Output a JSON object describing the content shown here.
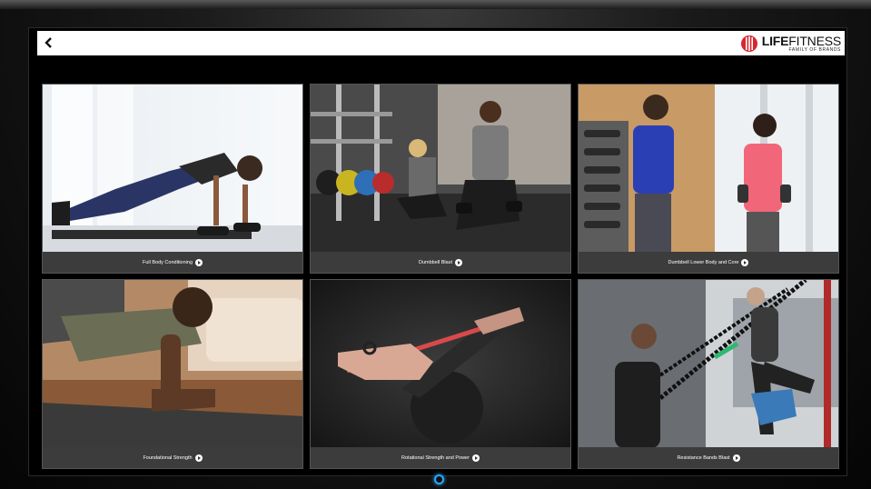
{
  "header": {
    "back_icon": "chevron-left-icon",
    "brand_name_bold": "LIFE",
    "brand_name_light": "FITNESS",
    "brand_subtitle": "FAMILY OF BRANDS",
    "brand_color": "#d7262f"
  },
  "workouts": [
    {
      "title": "Full Body Conditioning",
      "photo": "woman doing dumbbell push-up in bright studio"
    },
    {
      "title": "Dumbbell Blast",
      "photo": "two people doing dumbbell lunges in gym"
    },
    {
      "title": "Dumbbell Lower Body and Core",
      "photo": "two women holding dumbbells by window"
    },
    {
      "title": "Foundational Strength",
      "photo": "man holding plank on yoga mat"
    },
    {
      "title": "Rotational Strength and Power",
      "photo": "hand gripping resistance band"
    },
    {
      "title": "Resistance Bands Blast",
      "photo": "two people using resistance band training frame"
    }
  ],
  "colors": {
    "screen_bg": "#000000",
    "caption_bg": "#3c3c3c",
    "home_ring": "#29a8ff"
  }
}
